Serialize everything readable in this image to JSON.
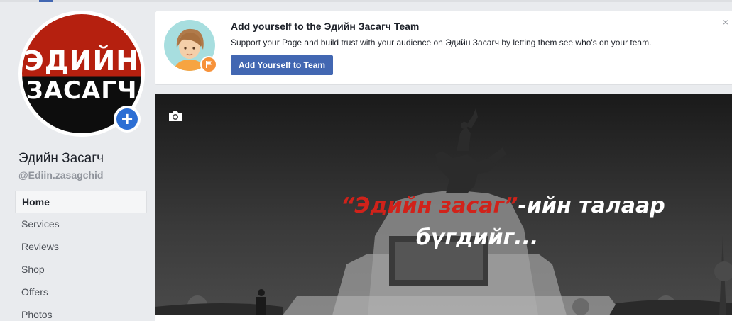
{
  "profile": {
    "logo_line1": "ЭДИЙН",
    "logo_line2": "ЗАСАГЧ",
    "name": "Эдийн Засагч",
    "handle": "@Ediin.zasagchid"
  },
  "nav": {
    "items": [
      {
        "label": "Home",
        "active": true
      },
      {
        "label": "Services"
      },
      {
        "label": "Reviews"
      },
      {
        "label": "Shop"
      },
      {
        "label": "Offers"
      },
      {
        "label": "Photos"
      }
    ]
  },
  "banner": {
    "title": "Add yourself to the Эдийн Засагч Team",
    "text": "Support your Page and build trust with your audience on Эдийн Засагч by letting them see who's on your team.",
    "button_label": "Add Yourself to Team",
    "close_glyph": "×"
  },
  "cover": {
    "quote_open": "“",
    "highlight": "Эдийн засаг",
    "quote_close": "”",
    "line1_rest": "-ийн  талаар",
    "line2": "бүгдийг..."
  },
  "icons": {
    "add_photo": "plus-icon",
    "camera": "camera-icon",
    "badge": "flag-icon"
  },
  "colors": {
    "brand_blue": "#4267b2",
    "logo_red": "#b5200f",
    "highlight_red": "#d0221a"
  }
}
